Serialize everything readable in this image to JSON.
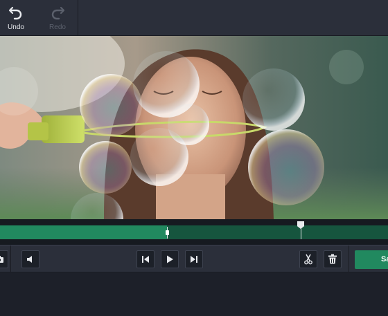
{
  "toolbar": {
    "undo": {
      "label": "Undo",
      "icon": "undo-arrow-icon"
    },
    "redo": {
      "label": "Redo",
      "icon": "redo-arrow-icon"
    }
  },
  "video": {
    "description_icon": "video-frame-image"
  },
  "timeline": {
    "trim_position": 0.43,
    "playhead_position": 0.775
  },
  "controls": {
    "snapshot_icon": "camera-icon",
    "volume_icon": "speaker-icon",
    "prev_icon": "skip-back-icon",
    "play_icon": "play-icon",
    "next_icon": "skip-forward-icon",
    "cut_icon": "scissors-icon",
    "delete_icon": "trash-icon",
    "save_label": "Sa"
  },
  "colors": {
    "accent": "#21895f",
    "panel": "#2b2f3a",
    "background": "#1d2029"
  }
}
